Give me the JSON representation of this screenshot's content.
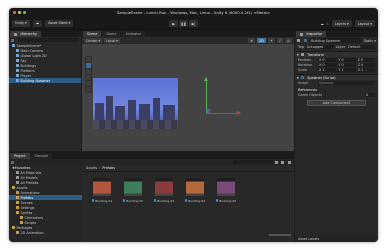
{
  "window": {
    "title": "SampleScene - Lunch-Run - Windows, Mac, Linux - Unity 6 (6000.0.2f1) <Metal>"
  },
  "toolbar": {
    "account": "Unity ▾",
    "cloud": "☁",
    "asset_store": "Asset Store ▾",
    "layers": "Layers ▾",
    "layout": "Layout ▾"
  },
  "hierarchy": {
    "tab": "Hierarchy",
    "items": [
      {
        "label": "SampleScene*",
        "indent": 0
      },
      {
        "label": "Main Camera",
        "indent": 1
      },
      {
        "label": "Global Light 2D",
        "indent": 1
      },
      {
        "label": "Sky",
        "indent": 1
      },
      {
        "label": "Buildings",
        "indent": 1
      },
      {
        "label": "Platform",
        "indent": 1
      },
      {
        "label": "Player",
        "indent": 1
      },
      {
        "label": "Building Spawner",
        "indent": 1,
        "selected": true
      }
    ]
  },
  "scene": {
    "tabs": [
      "Scene",
      "Game",
      "Animator"
    ],
    "toolbar": [
      "Center ▾",
      "Local ▾",
      "2D"
    ]
  },
  "inspector": {
    "tab": "Inspector",
    "object_name": "Building Spawner",
    "static": "Static ▾",
    "tag_label": "Tag",
    "tag": "Untagged",
    "layer_label": "Layer",
    "layer": "Default",
    "transform": {
      "title": "Transform",
      "rows": [
        {
          "label": "Position",
          "x": "X 0",
          "y": "Y 0",
          "z": "Z 0"
        },
        {
          "label": "Rotation",
          "x": "X 0",
          "y": "Y 0",
          "z": "Z 0"
        },
        {
          "label": "Scale",
          "x": "X 1",
          "y": "Y 1",
          "z": "Z 1"
        }
      ]
    },
    "script": {
      "title": "Spawner (Script)",
      "field_label": "Script",
      "field_value": "Spawner"
    },
    "references": {
      "title": "References",
      "field_label": "Game Objects",
      "field_value": "0"
    },
    "add_component": "Add Component",
    "footer": "Asset Labels"
  },
  "project": {
    "tabs": [
      "Project",
      "Console"
    ],
    "favorites": [
      "All Materials",
      "All Models",
      "All Prefabs"
    ],
    "tree": [
      {
        "label": "Assets",
        "indent": 0
      },
      {
        "label": "Animations",
        "indent": 1
      },
      {
        "label": "Prefabs",
        "indent": 1,
        "selected": true
      },
      {
        "label": "Scenes",
        "indent": 1
      },
      {
        "label": "Settings",
        "indent": 1
      },
      {
        "label": "Sprites",
        "indent": 1
      },
      {
        "label": "Characters",
        "indent": 2
      },
      {
        "label": "Scripts",
        "indent": 2
      },
      {
        "label": "Packages",
        "indent": 0
      },
      {
        "label": "2D Animation",
        "indent": 1
      }
    ],
    "breadcrumb": [
      "Assets",
      "Prefabs"
    ],
    "assets": [
      {
        "label": "Building 01",
        "color": "#b4553f"
      },
      {
        "label": "Building 02",
        "color": "#3e7e5a"
      },
      {
        "label": "Building 03",
        "color": "#8b3b3b"
      },
      {
        "label": "Building 04",
        "color": "#b46a3a"
      },
      {
        "label": "Building 05",
        "color": "#7a4a7a"
      }
    ]
  }
}
